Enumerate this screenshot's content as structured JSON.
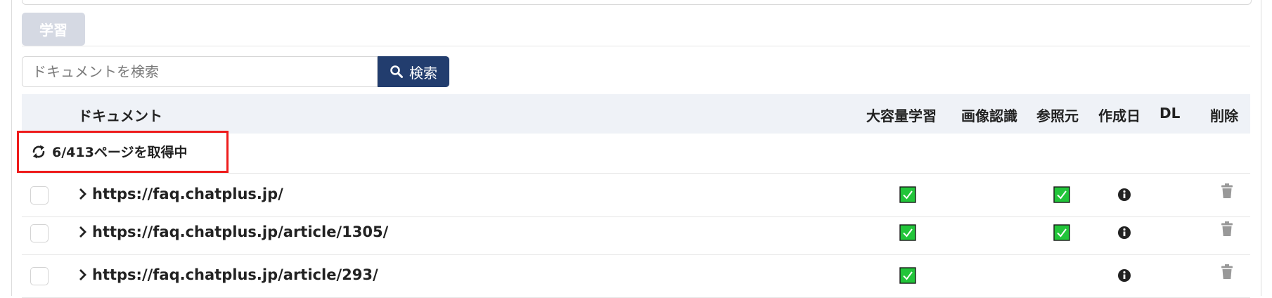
{
  "toolbar": {
    "learn_label": "学習"
  },
  "search": {
    "placeholder": "ドキュメントを検索",
    "button_label": "検索"
  },
  "table": {
    "headers": {
      "document": "ドキュメント",
      "large_volume": "大容量学習",
      "image_recognition": "画像認識",
      "reference": "参照元",
      "created": "作成日",
      "dl": "DL",
      "delete": "削除"
    },
    "status_text": "6/413ページを取得中",
    "rows": [
      {
        "url": "https://faq.chatplus.jp/",
        "large_volume": true,
        "image_recognition": false,
        "reference": true
      },
      {
        "url": "https://faq.chatplus.jp/article/1305/",
        "large_volume": true,
        "image_recognition": false,
        "reference": true
      },
      {
        "url": "https://faq.chatplus.jp/article/293/",
        "large_volume": true,
        "image_recognition": false,
        "reference": false
      }
    ]
  },
  "colors": {
    "accent_button": "#223d6e",
    "disabled_button": "#d5d9e3",
    "header_bg": "#eff2f7",
    "highlight_border": "#ee1c1c",
    "check_green": "#22c53a"
  }
}
